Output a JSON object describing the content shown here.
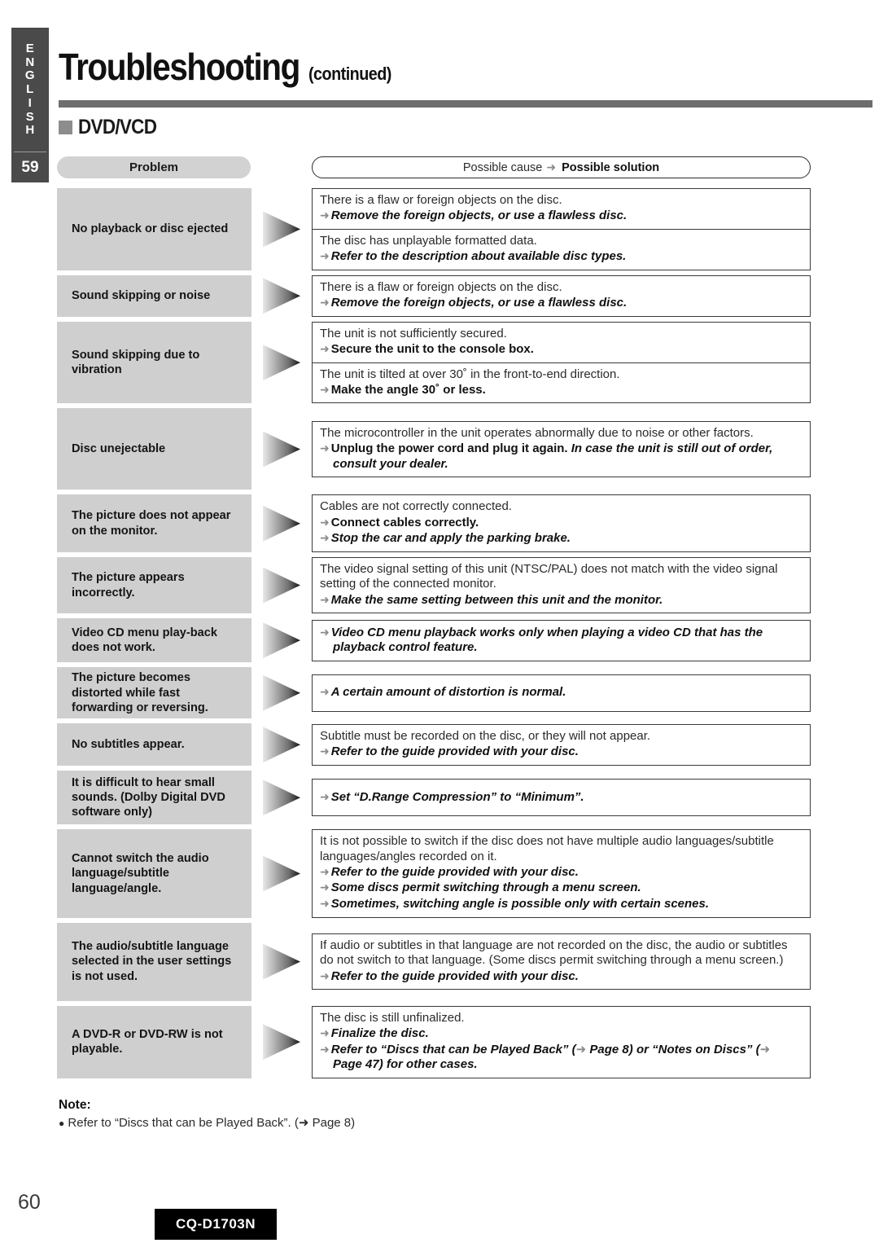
{
  "sidebar": {
    "language_letters": [
      "E",
      "N",
      "G",
      "L",
      "I",
      "S",
      "H"
    ],
    "page_ref": "59"
  },
  "header": {
    "title": "Troubleshooting",
    "title_suffix": "(continued)",
    "section": "DVD/VCD"
  },
  "columns": {
    "problem_label": "Problem",
    "cause_label": "Possible cause",
    "solution_label": "Possible solution",
    "arrow_glyph": "➜"
  },
  "rows": [
    {
      "problem": "No playback or disc ejected",
      "min_height": 78,
      "boxes": [
        {
          "cause": "There is a flaw or foreign objects on the disc.",
          "solutions": [
            {
              "text": "Remove the foreign objects, or use a flawless disc.",
              "style": "bold-italic"
            }
          ]
        },
        {
          "cause": "The disc has unplayable formatted data.",
          "solutions": [
            {
              "text": "Refer to the description about available disc types.",
              "style": "bold-italic"
            }
          ]
        }
      ]
    },
    {
      "problem": "Sound skipping or noise",
      "min_height": 48,
      "boxes": [
        {
          "cause": "There is a flaw or foreign objects on the disc.",
          "solutions": [
            {
              "text": "Remove the foreign objects, or use a flawless disc.",
              "style": "bold-italic"
            }
          ]
        }
      ]
    },
    {
      "problem": "Sound skipping due to vibration",
      "min_height": 78,
      "boxes": [
        {
          "cause": "The unit is not sufficiently secured.",
          "solutions": [
            {
              "text": "Secure the unit to the console box.",
              "style": "bold"
            }
          ]
        },
        {
          "cause": "The unit is tilted at over 30˚ in the front-to-end direction.",
          "solutions": [
            {
              "text": "Make the angle 30˚ or less.",
              "style": "bold"
            }
          ]
        }
      ]
    },
    {
      "problem": "Disc unejectable",
      "min_height": 100,
      "boxes": [
        {
          "cause": "The microcontroller in the unit operates abnormally due to noise or other factors.",
          "solutions": [
            {
              "text_bold": "Unplug the power cord and plug it again.",
              "text_italic": "In case the unit is still out of order, consult your dealer.",
              "style": "bold-then-italic"
            }
          ]
        }
      ]
    },
    {
      "problem": "The picture does not appear on the monitor.",
      "min_height": 62,
      "boxes": [
        {
          "cause": "Cables are not correctly connected.",
          "solutions": [
            {
              "text": "Connect cables correctly.",
              "style": "bold"
            },
            {
              "text": "Stop the car and apply the parking brake.",
              "style": "bold-italic"
            }
          ]
        }
      ]
    },
    {
      "problem": "The picture appears incorrectly.",
      "min_height": 62,
      "boxes": [
        {
          "cause": "The video signal setting of this unit (NTSC/PAL) does not match with the video signal setting of the connected monitor.",
          "solutions": [
            {
              "text": "Make the same setting between this unit and the monitor.",
              "style": "bold-italic"
            }
          ]
        }
      ]
    },
    {
      "problem": "Video CD menu play-back does not work.",
      "min_height": 54,
      "boxes": [
        {
          "cause": "",
          "solutions": [
            {
              "text": "Video CD menu playback works only when playing a video CD that has the playback control feature.",
              "style": "bold-italic"
            }
          ]
        }
      ]
    },
    {
      "problem": "The picture becomes distorted while fast forwarding or reversing.",
      "min_height": 62,
      "boxes": [
        {
          "cause": "",
          "solutions": [
            {
              "text": "A certain amount of distortion is normal.",
              "style": "bold-italic"
            }
          ]
        }
      ]
    },
    {
      "problem": "No subtitles appear.",
      "min_height": 52,
      "boxes": [
        {
          "cause": "Subtitle must be recorded on the disc, or they will not appear.",
          "solutions": [
            {
              "text": "Refer to the guide provided with your disc.",
              "style": "bold-italic"
            }
          ]
        }
      ]
    },
    {
      "problem": "It is difficult to hear small sounds. (Dolby Digital DVD software only)",
      "min_height": 66,
      "boxes": [
        {
          "cause": "",
          "solutions": [
            {
              "text": "Set “D.Range Compression” to “Minimum”.",
              "style": "bold-italic"
            }
          ]
        }
      ]
    },
    {
      "problem": "Cannot switch the audio language/subtitle language/angle.",
      "min_height": 96,
      "boxes": [
        {
          "cause": "It is not possible to switch if the disc does not have multiple audio languages/subtitle languages/angles recorded on it.",
          "solutions": [
            {
              "text": "Refer to the guide provided with your disc.",
              "style": "bold-italic"
            },
            {
              "text": "Some discs permit switching through a menu screen.",
              "style": "bold-italic"
            },
            {
              "text": "Sometimes, switching angle is possible only with certain scenes.",
              "style": "bold-italic"
            }
          ]
        }
      ]
    },
    {
      "problem": "The audio/subtitle language selected in the user settings is not used.",
      "min_height": 96,
      "boxes": [
        {
          "cause": "If audio or subtitles in that language are not recorded on the disc, the audio or subtitles do not switch to that language. (Some discs permit switching through a menu screen.)",
          "solutions": [
            {
              "text": "Refer to the guide provided with your disc.",
              "style": "bold-italic"
            }
          ]
        }
      ]
    },
    {
      "problem": "A DVD-R or DVD-RW is not playable.",
      "min_height": 82,
      "boxes": [
        {
          "cause": "The disc is still unfinalized.",
          "solutions": [
            {
              "text": "Finalize the disc.",
              "style": "bold-italic"
            },
            {
              "text": "Refer to “Discs that can be Played Back” (➜ Page 8) or “Notes on Discs” (➜ Page 47) for other cases.",
              "style": "bold-italic-cont"
            }
          ]
        }
      ]
    }
  ],
  "note": {
    "heading": "Note:",
    "body": "Refer to “Discs that can be Played Back”. (➜ Page 8)"
  },
  "footer": {
    "page_number": "60",
    "model": "CQ-D1703N"
  }
}
